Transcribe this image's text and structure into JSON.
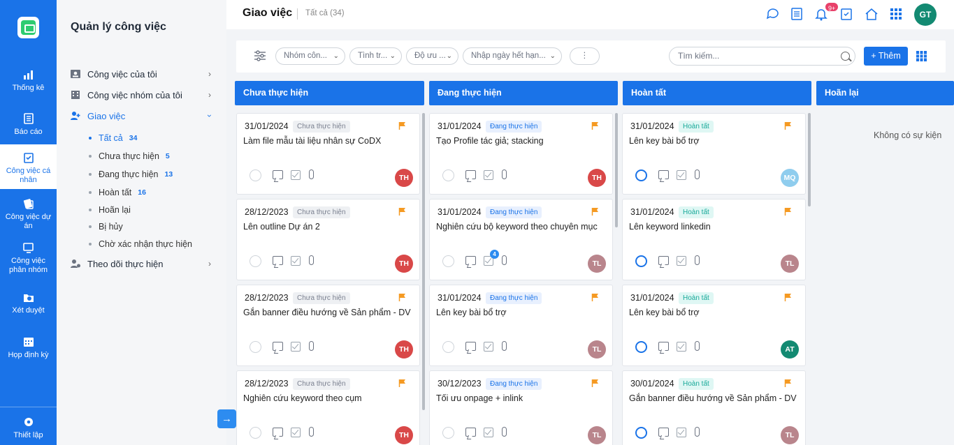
{
  "rail": {
    "items": [
      {
        "label": "Thống kê",
        "icon": "bar-chart-icon"
      },
      {
        "label": "Báo cáo",
        "icon": "report-icon"
      },
      {
        "label": "Công việc cá nhân",
        "icon": "personal-task-icon"
      },
      {
        "label": "Công việc dự án",
        "icon": "project-task-icon"
      },
      {
        "label": "Công việc phân nhóm",
        "icon": "group-task-icon"
      },
      {
        "label": "Xét duyệt",
        "icon": "approval-icon"
      },
      {
        "label": "Họp định kỳ",
        "icon": "calendar-icon"
      }
    ],
    "settings_label": "Thiết lập"
  },
  "sidebar": {
    "title": "Quản lý công việc",
    "items": [
      {
        "label": "Công việc của tôi"
      },
      {
        "label": "Công việc nhóm của tôi"
      },
      {
        "label": "Giao việc"
      },
      {
        "label": "Theo dõi thực hiện"
      }
    ],
    "sub_items": [
      {
        "label": "Tất cả",
        "count": "34"
      },
      {
        "label": "Chưa thực hiện",
        "count": "5"
      },
      {
        "label": "Đang thực hiện",
        "count": "13"
      },
      {
        "label": "Hoàn tất",
        "count": "16"
      },
      {
        "label": "Hoãn lại",
        "count": ""
      },
      {
        "label": "Bị hủy",
        "count": ""
      },
      {
        "label": "Chờ xác nhận thực hiện",
        "count": ""
      }
    ]
  },
  "header": {
    "title": "Giao việc",
    "subtitle": "Tất cả (34)",
    "notification_badge": "9+",
    "user_initials": "GT"
  },
  "toolbar": {
    "filters": [
      "Nhóm côn...",
      "Tình tr...",
      "Độ ưu ...",
      "Nhập ngày hết hạn..."
    ],
    "search_placeholder": "Tìm kiếm...",
    "add_label": "+ Thêm"
  },
  "columns": [
    {
      "title": "Chưa thực hiện",
      "cards": [
        {
          "date": "31/01/2024",
          "status": "Chưa thực hiện",
          "title": "Làm file mẫu tài liệu nhân sự CoDX",
          "assignee": "TH",
          "done_circle": false,
          "checklist_count": ""
        },
        {
          "date": "28/12/2023",
          "status": "Chưa thực hiện",
          "title": "Lên outline Dự án 2",
          "assignee": "TH",
          "done_circle": false,
          "checklist_count": ""
        },
        {
          "date": "28/12/2023",
          "status": "Chưa thực hiện",
          "title": "Gắn banner điều hướng về Sản phẩm - DV",
          "assignee": "TH",
          "done_circle": false,
          "checklist_count": ""
        },
        {
          "date": "28/12/2023",
          "status": "Chưa thực hiện",
          "title": "Nghiên cứu keyword theo cụm",
          "assignee": "TH",
          "done_circle": false,
          "checklist_count": ""
        }
      ]
    },
    {
      "title": "Đang thực hiện",
      "cards": [
        {
          "date": "31/01/2024",
          "status": "Đang thực hiện",
          "title": "Tạo Profile tác giả; stacking",
          "assignee": "TH",
          "done_circle": false,
          "checklist_count": ""
        },
        {
          "date": "31/01/2024",
          "status": "Đang thực hiện",
          "title": "Nghiên cứu bộ keyword theo chuyên mục",
          "assignee": "TL",
          "done_circle": false,
          "checklist_count": "4"
        },
        {
          "date": "31/01/2024",
          "status": "Đang thực hiện",
          "title": "Lên key bài bổ trợ",
          "assignee": "TL",
          "done_circle": false,
          "checklist_count": ""
        },
        {
          "date": "30/12/2023",
          "status": "Đang thực hiện",
          "title": "Tối ưu onpage + inlink",
          "assignee": "TL",
          "done_circle": false,
          "checklist_count": ""
        }
      ]
    },
    {
      "title": "Hoàn tất",
      "cards": [
        {
          "date": "31/01/2024",
          "status": "Hoàn tất",
          "title": "Lên key bài bổ trợ",
          "assignee": "MQ",
          "done_circle": true,
          "checklist_count": ""
        },
        {
          "date": "31/01/2024",
          "status": "Hoàn tất",
          "title": "Lên keyword linkedin",
          "assignee": "TL",
          "done_circle": true,
          "checklist_count": ""
        },
        {
          "date": "31/01/2024",
          "status": "Hoàn tất",
          "title": "Lên key bài bổ trợ",
          "assignee": "AT",
          "done_circle": true,
          "checklist_count": ""
        },
        {
          "date": "30/01/2024",
          "status": "Hoàn tất",
          "title": "Gắn banner điều hướng về Sản phẩm - DV",
          "assignee": "TL",
          "done_circle": true,
          "checklist_count": ""
        }
      ]
    },
    {
      "title": "Hoãn lại",
      "cards": [],
      "empty_text": "Không có sự kiện"
    }
  ],
  "colors": {
    "primary": "#1a73e8",
    "avatar_TH": "#d94848",
    "avatar_TL": "#b9858c",
    "avatar_MQ": "#8fcdee",
    "avatar_AT": "#138a72",
    "flag": "#f59a23"
  }
}
